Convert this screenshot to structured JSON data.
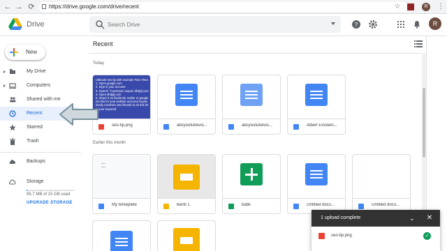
{
  "browser": {
    "url": "https://drive.google.com/drive/recent",
    "back_icon": "←",
    "forward_icon": "→",
    "reload_icon": "⟳",
    "star_icon": "☆",
    "avatar_letter": "R",
    "menu_icon": "⋮"
  },
  "app": {
    "title": "Drive",
    "search_placeholder": "Search Drive",
    "avatar_letter": "R"
  },
  "sidebar": {
    "new_label": "New",
    "items": [
      {
        "label": "My Drive"
      },
      {
        "label": "Computers"
      },
      {
        "label": "Shared with me"
      },
      {
        "label": "Recent"
      },
      {
        "label": "Starred"
      },
      {
        "label": "Trash"
      },
      {
        "label": "Backups"
      },
      {
        "label": "Storage"
      }
    ],
    "storage_used": "95.7 MB of 15 GB used",
    "storage_fraction": 0.006,
    "upgrade_label": "UPGRADE STORAGE"
  },
  "main": {
    "title": "Recent",
    "sections": [
      {
        "label": "Today"
      },
      {
        "label": "Earlier this month"
      }
    ],
    "files": [
      {
        "name": "seo-tip.png",
        "type": "image"
      },
      {
        "name": "abcyoutubevoi...",
        "type": "doc"
      },
      {
        "name": "abcyoutubevoi...",
        "type": "doc"
      },
      {
        "name": "Albert Einstein...",
        "type": "doc"
      },
      {
        "name": "My temeplete",
        "type": "doc"
      },
      {
        "name": "Banti 1",
        "type": "slides"
      },
      {
        "name": "babli",
        "type": "sheet"
      },
      {
        "name": "Untitled docu...",
        "type": "doc"
      },
      {
        "name": "Untitled docu...",
        "type": "doc"
      }
    ],
    "seo_thumb_lines": [
      "Ultimate seo tip with example #seo #seo",
      "1. Open google.com",
      "2. Sign in your account",
      "3. Search ' Facebook coupon dhdjdj.com",
      "4. Open dhdjdj.com",
      "5. Share it on facebook, twitter or google",
      "Do this for your website and your keywo",
      "family members and friends to do this for",
      "in your keyword"
    ]
  },
  "toast": {
    "title": "1 upload complete",
    "file": "seo-tip.png",
    "chevron": "⌄",
    "close": "✕",
    "check": "✓"
  },
  "colors": {
    "accent": "#1a73e8",
    "active_bg": "#e8f0fe",
    "doc": "#4285f4",
    "slides": "#f4b400",
    "sheet": "#0f9d58",
    "image": "#ea4335"
  }
}
